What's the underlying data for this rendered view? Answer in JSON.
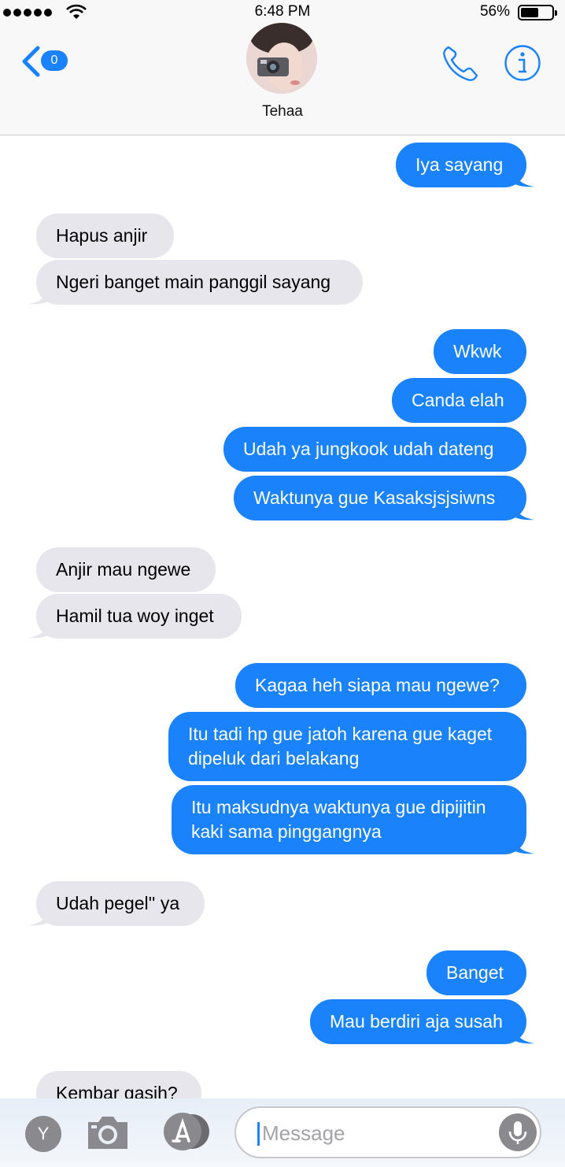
{
  "status_bar": {
    "time": "6:48 PM",
    "battery_percent": "56%",
    "battery_level": 0.56,
    "signal_dots": 5
  },
  "header": {
    "back_badge": "0",
    "contact_name": "Tehaa"
  },
  "messages": [
    {
      "dir": "out",
      "lines": [
        "Iya sayang"
      ]
    },
    {
      "dir": "in",
      "lines": [
        "Hapus anjir"
      ]
    },
    {
      "dir": "in",
      "lines": [
        "Ngeri banget main panggil sayang"
      ]
    },
    {
      "dir": "out",
      "lines": [
        "Wkwk"
      ]
    },
    {
      "dir": "out",
      "lines": [
        "Canda elah"
      ]
    },
    {
      "dir": "out",
      "lines": [
        "Udah ya jungkook udah dateng"
      ]
    },
    {
      "dir": "out",
      "lines": [
        "Waktunya gue Kasaksjsjsiwns"
      ]
    },
    {
      "dir": "in",
      "lines": [
        "Anjir mau ngewe"
      ]
    },
    {
      "dir": "in",
      "lines": [
        "Hamil tua woy inget"
      ]
    },
    {
      "dir": "out",
      "lines": [
        "Kagaa heh siapa mau ngewe?"
      ]
    },
    {
      "dir": "out",
      "lines": [
        "Itu tadi hp gue jatoh karena gue kaget",
        "dipeluk dari belakang"
      ]
    },
    {
      "dir": "out",
      "lines": [
        "Itu maksudnya waktunya gue dipijitin",
        "kaki sama pinggangnya"
      ]
    },
    {
      "dir": "in",
      "lines": [
        "Udah pegel'' ya"
      ]
    },
    {
      "dir": "out",
      "lines": [
        "Banget"
      ]
    },
    {
      "dir": "out",
      "lines": [
        "Mau berdiri aja susah"
      ]
    },
    {
      "dir": "in",
      "lines": [
        "Kembar gasih?"
      ]
    }
  ],
  "composer": {
    "y_button": "Y",
    "placeholder": "Message"
  },
  "icons": {
    "back": "chevron-left-icon",
    "call": "phone-icon",
    "info": "info-icon",
    "camera": "camera-icon",
    "apps": "app-store-icon",
    "mic": "microphone-icon"
  },
  "colors": {
    "accent": "#1a82fb",
    "incoming_bubble": "#e7e6ec",
    "outgoing_text": "#ffffff"
  }
}
